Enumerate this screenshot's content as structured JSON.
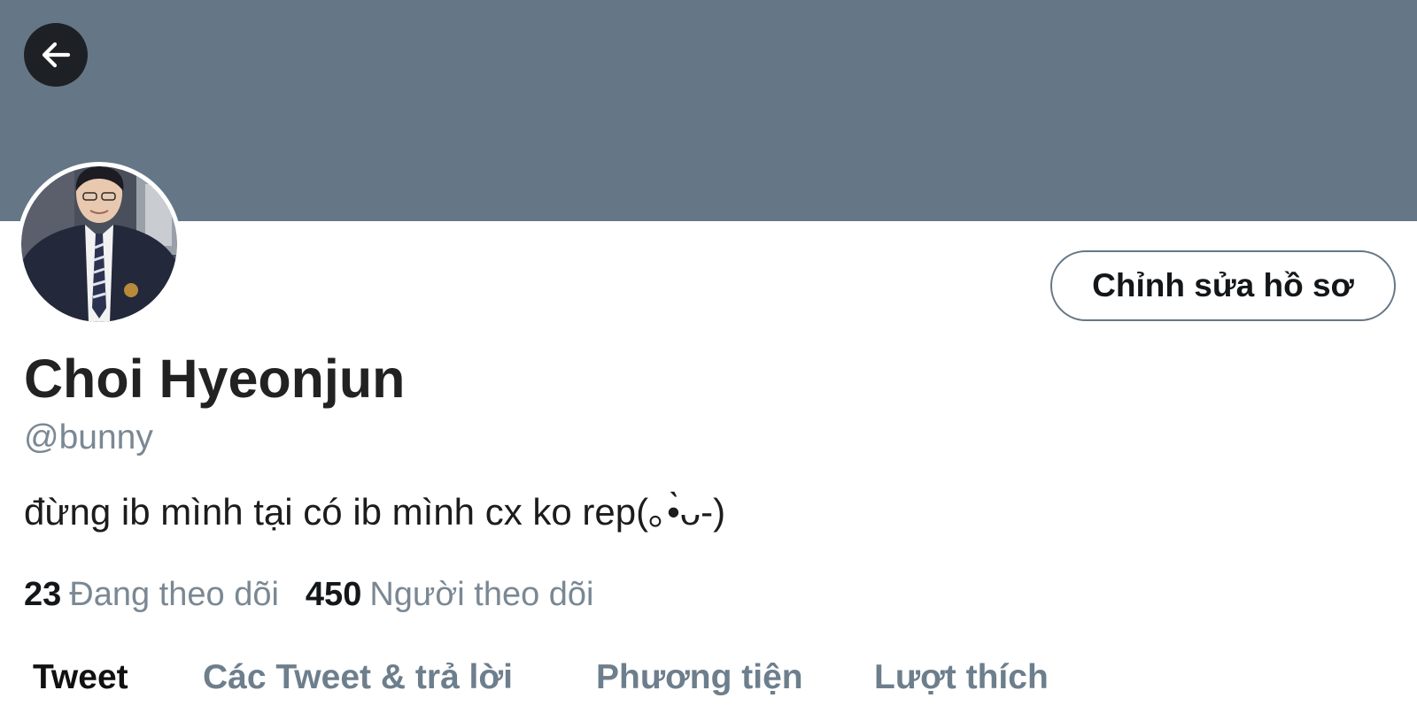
{
  "header": {
    "back_icon": "arrow-left-icon",
    "banner_color": "#657786"
  },
  "profile": {
    "avatar_alt": "profile-photo",
    "edit_button_label": "Chỉnh sửa hồ sơ",
    "display_name": "Choi Hyeonjun",
    "handle": "@bunny",
    "bio": "đừng ib mình tại có ib mình cx ko rep(｡•̀ᴗ-)"
  },
  "stats": {
    "following_count": "23",
    "following_label": "Đang theo dõi",
    "followers_count": "450",
    "followers_label": "Người theo dõi"
  },
  "tabs": [
    {
      "label": "Tweet",
      "active": true
    },
    {
      "label": "Các Tweet & trả lời",
      "active": false
    },
    {
      "label": "Phương tiện",
      "active": false
    },
    {
      "label": "Lượt thích",
      "active": false
    }
  ]
}
